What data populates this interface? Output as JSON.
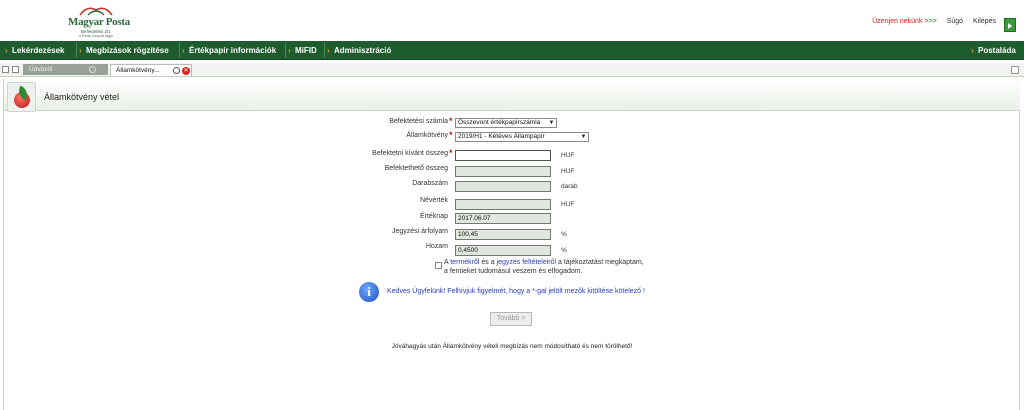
{
  "header": {
    "logo_title": "Magyar Posta",
    "logo_sub1": "Befektetési Zrt.",
    "logo_sub2": "a Posta Csoport tagja",
    "message_link": "Üzenjen nekünk >>>",
    "help_link": "Súgó",
    "logout_link": "Kilépés"
  },
  "nav": {
    "items": [
      "Lekérdezések",
      "Megbízások rögzítése",
      "Értékpapír információk",
      "MiFID",
      "Adminisztráció"
    ],
    "right_item": "Postaláda"
  },
  "tabs": {
    "inactive": "Üdvözöl",
    "active": "Államkötvény..."
  },
  "page": {
    "title": "Államkötvény vétel"
  },
  "form": {
    "account_label": "Befektetési számla",
    "account_value": "Összevont értékpapírszámla",
    "bond_label": "Államkötvény",
    "bond_value": "2019/H1 - Kétéves Állampapír",
    "amount_label": "Befektetni kívánt összeg",
    "amount_value": "",
    "amount_unit": "HUF",
    "investable_label": "Befektethető összeg",
    "investable_value": "",
    "investable_unit": "HUF",
    "quantity_label": "Darabszám",
    "quantity_value": "",
    "quantity_unit": "darab",
    "nominal_label": "Névérték",
    "nominal_value": "",
    "nominal_unit": "HUF",
    "value_date_label": "Értéknap",
    "value_date_value": "2017.06.07",
    "price_label": "Jegyzési árfolyam",
    "price_value": "100,45",
    "price_unit": "%",
    "yield_label": "Hozam",
    "yield_value": "0,4500",
    "yield_unit": "%",
    "terms_pre": "A ",
    "terms_link1": "termékről",
    "terms_mid": " és a ",
    "terms_link2": "jegyzés feltételeiről",
    "terms_post": " a tájékoztatást megkaptam,",
    "terms_line2": "a fentieket tudomásul veszem és elfogadom.",
    "info_text": "Kedves Ügyfelünk! Felhívjuk figyelmét, hogy a *-gal jelölt mezők kitöltése kötelező !",
    "next_button": "Tovább >",
    "footer_note": "Jóváhagyás után Államkötvény vételi megbízás nem módosítható és nem törölhető!"
  },
  "colors": {
    "nav_bg": "#1d5c2c",
    "required": "#d01818",
    "link": "#2a3db5"
  }
}
